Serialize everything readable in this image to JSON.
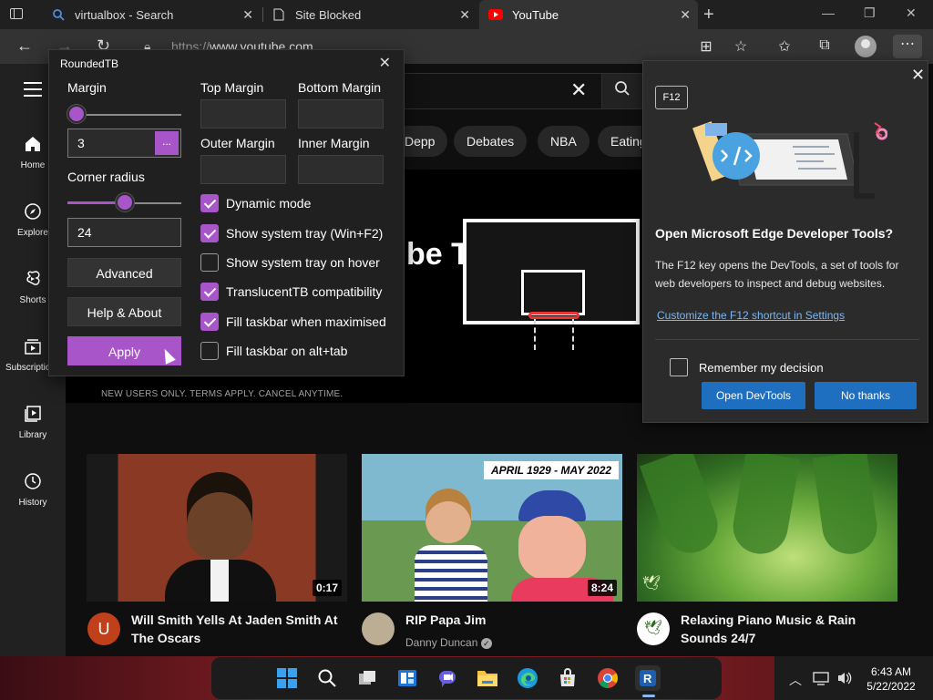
{
  "browser": {
    "tabs": [
      {
        "label": "virtualbox - Search"
      },
      {
        "label": "Site Blocked"
      },
      {
        "label": "YouTube"
      }
    ],
    "url_prefix": "https://",
    "url_host": "www.youtube.com"
  },
  "youtube": {
    "sidebar": [
      {
        "label": "Home"
      },
      {
        "label": "Explore"
      },
      {
        "label": "Shorts"
      },
      {
        "label": "Subscriptions"
      },
      {
        "label": "Library"
      },
      {
        "label": "History"
      }
    ],
    "chips": [
      "Depp",
      "Debates",
      "NBA",
      "Eating"
    ],
    "promo_title": "be TV",
    "promo_terms": "NEW USERS ONLY. TERMS APPLY. CANCEL ANYTIME.",
    "videos": [
      {
        "title": "Will Smith Yells At Jaden Smith At The Oscars",
        "channel": "",
        "duration": "0:17",
        "avatar_letter": "U",
        "avatar_color": "#c1401c"
      },
      {
        "title": "RIP Papa Jim",
        "channel": "Danny Duncan",
        "duration": "8:24",
        "banner": "APRIL 1929 - MAY 2022",
        "avatar_color": "#bcae95"
      },
      {
        "title": "Relaxing Piano Music & Rain Sounds 24/7",
        "channel": "",
        "duration": "",
        "avatar_color": "#ffffff"
      }
    ]
  },
  "roundedtb": {
    "title": "RoundedTB",
    "margin_label": "Margin",
    "margin_value": "3",
    "margin_slider": 0.05,
    "ellipsis": "...",
    "corner_label": "Corner radius",
    "corner_value": "24",
    "corner_slider": 0.5,
    "top_margin": "Top Margin",
    "bottom_margin": "Bottom Margin",
    "outer_margin": "Outer Margin",
    "inner_margin": "Inner Margin",
    "advanced": "Advanced",
    "help": "Help & About",
    "apply": "Apply",
    "options": [
      {
        "label": "Dynamic mode",
        "checked": true
      },
      {
        "label": "Show system tray (Win+F2)",
        "checked": true
      },
      {
        "label": "Show system tray on hover",
        "checked": false
      },
      {
        "label": "TranslucentTB compatibility",
        "checked": true
      },
      {
        "label": "Fill taskbar when maximised",
        "checked": true
      },
      {
        "label": "Fill taskbar on alt+tab",
        "checked": false
      }
    ]
  },
  "devtools": {
    "key": "F12",
    "title": "Open Microsoft Edge Developer Tools?",
    "body": "The F12 key opens the DevTools, a set of tools for web developers to inspect and debug websites.",
    "link": "Customize the F12 shortcut in Settings",
    "remember": "Remember my decision",
    "open_btn": "Open DevTools",
    "no_btn": "No thanks"
  },
  "taskbar": {
    "time": "6:43 AM",
    "date": "5/22/2022",
    "apps": [
      "start-icon",
      "search-icon",
      "task-view-icon",
      "widgets-icon",
      "teams-chat-icon",
      "file-explorer-icon",
      "edge-icon",
      "store-icon",
      "chrome-icon",
      "roundedtb-icon"
    ]
  },
  "colors": {
    "accent_purple": "#a755c9",
    "edge_blue": "#1f6fc0"
  }
}
